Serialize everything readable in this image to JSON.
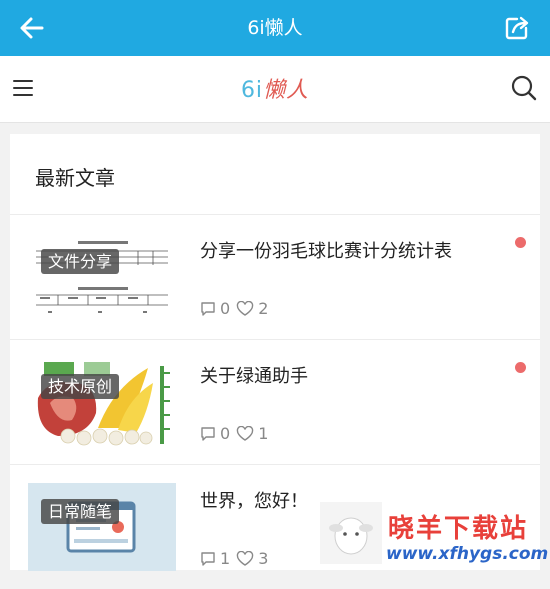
{
  "topbar": {
    "title": "6i懒人"
  },
  "navbar": {
    "logo_latin": "6i",
    "logo_cn": "懒人"
  },
  "section": {
    "title": "最新文章"
  },
  "articles": [
    {
      "category": "文件分享",
      "title": "分享一份羽毛球比赛计分统计表",
      "comments": "0",
      "likes": "2",
      "unread": true
    },
    {
      "category": "技术原创",
      "title": "关于绿通助手",
      "comments": "0",
      "likes": "1",
      "unread": true
    },
    {
      "category": "日常随笔",
      "title": "世界，您好！",
      "comments": "1",
      "likes": "3",
      "unread": false
    }
  ],
  "watermark": {
    "text": "晓羊下载站",
    "url": "www.xfhygs.com"
  },
  "colors": {
    "accent": "#20a9e1",
    "unread_dot": "#ec6b6b"
  }
}
